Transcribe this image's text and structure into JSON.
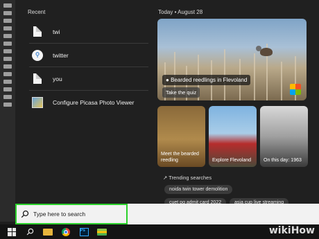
{
  "recent": {
    "title": "Recent",
    "items": [
      {
        "label": "twi",
        "icon": "document-icon"
      },
      {
        "label": "twitter",
        "icon": "search-icon"
      },
      {
        "label": "you",
        "icon": "document-icon"
      },
      {
        "label": "Configure Picasa Photo Viewer",
        "icon": "picasa-icon"
      }
    ]
  },
  "today": {
    "title": "Today  •  August 28",
    "hero": {
      "caption": "Bearded reedlings in Flevoland",
      "quiz": "Take the quiz"
    },
    "cards": [
      {
        "caption_line1": "Meet the bearded",
        "caption_line2": "reedling"
      },
      {
        "caption_line1": "Explore Flevoland",
        "caption_line2": ""
      },
      {
        "caption_line1": "On this day: 1963",
        "caption_line2": ""
      }
    ],
    "trending_title": "Trending searches",
    "trending": [
      "noida twin tower demolition",
      "cuet pg admit card 2022",
      "asia cup live streaming"
    ]
  },
  "search": {
    "placeholder": "Type here to search"
  },
  "watermark": "wikiHow"
}
